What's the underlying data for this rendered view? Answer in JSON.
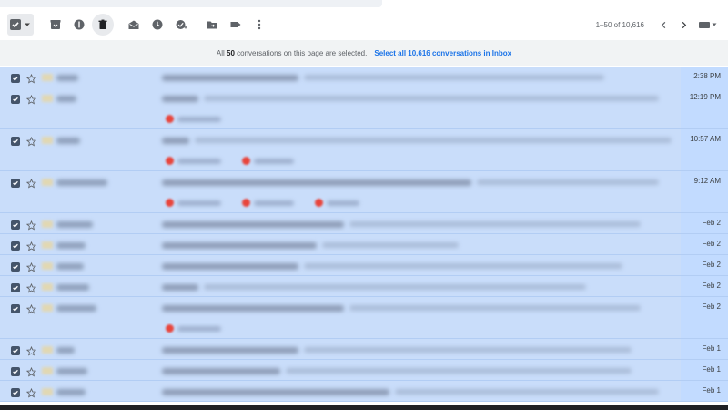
{
  "toolbar": {
    "icons": [
      "select-all-checkbox",
      "archive-icon",
      "report-spam-icon",
      "delete-icon",
      "mark-as-read-icon",
      "snooze-icon",
      "add-to-tasks-icon",
      "move-to-icon",
      "label-icon",
      "more-icon"
    ]
  },
  "pagination": {
    "range": "1–50 of 10,616"
  },
  "banner": {
    "prefix": "All",
    "count": "50",
    "suffix": "conversations on this page are selected.",
    "select_all_link": "Select all 10,616 conversations in Inbox"
  },
  "emails": [
    {
      "time": "2:38 PM",
      "chips": 0
    },
    {
      "time": "12:19 PM",
      "chips": 1
    },
    {
      "time": "10:57 AM",
      "chips": 2
    },
    {
      "time": "9:12 AM",
      "chips": 3
    },
    {
      "time": "Feb 2",
      "chips": 0
    },
    {
      "time": "Feb 2",
      "chips": 0
    },
    {
      "time": "Feb 2",
      "chips": 0
    },
    {
      "time": "Feb 2",
      "chips": 0
    },
    {
      "time": "Feb 2",
      "chips": 1
    },
    {
      "time": "Feb 1",
      "chips": 0
    },
    {
      "time": "Feb 1",
      "chips": 0
    },
    {
      "time": "Feb 1",
      "chips": 0
    }
  ],
  "colors": {
    "selected_row": "#c2dbff",
    "link": "#1a73e8",
    "banner_bg": "#f1f3f4"
  }
}
